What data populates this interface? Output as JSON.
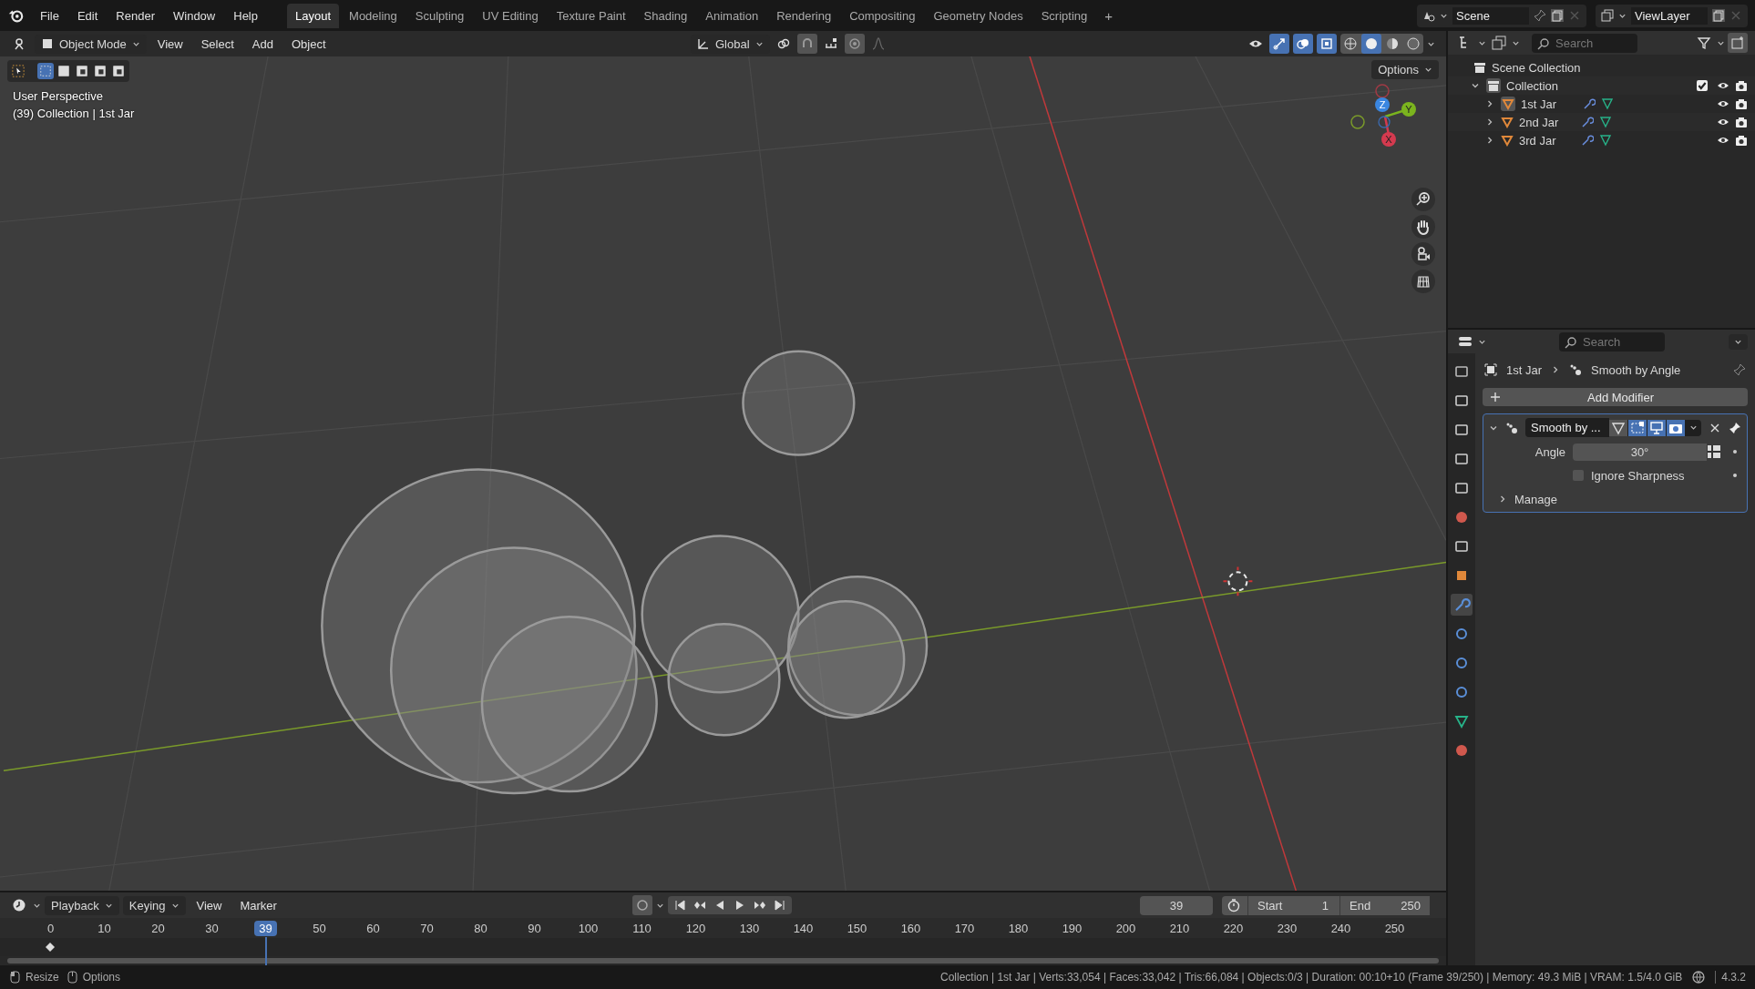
{
  "topbar": {
    "menus": [
      "File",
      "Edit",
      "Render",
      "Window",
      "Help"
    ],
    "workspaces": [
      {
        "label": "Layout",
        "selected": true
      },
      {
        "label": "Modeling",
        "selected": false
      },
      {
        "label": "Sculpting",
        "selected": false
      },
      {
        "label": "UV Editing",
        "selected": false
      },
      {
        "label": "Texture Paint",
        "selected": false
      },
      {
        "label": "Shading",
        "selected": false
      },
      {
        "label": "Animation",
        "selected": false
      },
      {
        "label": "Rendering",
        "selected": false
      },
      {
        "label": "Compositing",
        "selected": false
      },
      {
        "label": "Geometry Nodes",
        "selected": false
      },
      {
        "label": "Scripting",
        "selected": false
      }
    ],
    "add_tab": "+",
    "scene": "Scene",
    "view_layer": "ViewLayer"
  },
  "viewport": {
    "mode": "Object Mode",
    "menus": [
      "View",
      "Select",
      "Add",
      "Object"
    ],
    "orientation": "Global",
    "options": "Options",
    "select_modes": [
      {
        "selected": true
      },
      {
        "selected": false
      },
      {
        "selected": false
      },
      {
        "selected": false
      },
      {
        "selected": false
      }
    ],
    "shading": [
      {
        "selected": false
      },
      {
        "selected": true
      },
      {
        "selected": false
      },
      {
        "selected": false
      }
    ],
    "overlay_lines": [
      "User Perspective",
      "(39) Collection | 1st Jar"
    ],
    "axes": [
      "X",
      "Y",
      "Z"
    ]
  },
  "outliner": {
    "search_placeholder": "Search",
    "tree": [
      {
        "label": "Scene Collection",
        "children": [
          {
            "label": "Collection",
            "expanded": true,
            "checked": true,
            "children": [
              {
                "label": "1st Jar",
                "expanded": false,
                "selected": true
              },
              {
                "label": "2nd Jar",
                "expanded": false,
                "selected": false
              },
              {
                "label": "3rd Jar",
                "expanded": false,
                "selected": false
              }
            ]
          }
        ]
      }
    ]
  },
  "properties": {
    "search_placeholder": "Search",
    "tabs": [
      {
        "kind": "tool",
        "selected": false
      },
      {
        "kind": "render",
        "selected": false
      },
      {
        "kind": "output",
        "selected": false
      },
      {
        "kind": "viewlayer",
        "selected": false
      },
      {
        "kind": "scene",
        "selected": false
      },
      {
        "kind": "world",
        "selected": false
      },
      {
        "kind": "collection",
        "selected": false
      },
      {
        "kind": "object",
        "selected": false
      },
      {
        "kind": "modifier",
        "selected": true
      },
      {
        "kind": "particles",
        "selected": false
      },
      {
        "kind": "physics",
        "selected": false
      },
      {
        "kind": "constraints",
        "selected": false
      },
      {
        "kind": "data",
        "selected": false
      },
      {
        "kind": "material",
        "selected": false
      }
    ],
    "object": "1st Jar",
    "modifier": "Smooth by Angle",
    "add_button": "Add Modifier",
    "panel": {
      "name": "Smooth by ...",
      "expanded": true,
      "toggles": [
        {
          "kind": "editmode",
          "on": false
        },
        {
          "kind": "cage",
          "on": true
        },
        {
          "kind": "viewport",
          "on": true
        },
        {
          "kind": "render",
          "on": true
        }
      ],
      "angle_label": "Angle",
      "angle": "30°",
      "ignore_label": "Ignore Sharpness",
      "ignore_checked": false,
      "manage": "Manage",
      "manage_expanded": false
    }
  },
  "timeline": {
    "menus": [
      "Playback",
      "Keying",
      "View",
      "Marker"
    ],
    "current_frame": "39",
    "start_label": "Start",
    "start": "1",
    "end_label": "End",
    "end": "250",
    "ticks": [
      {
        "label": "0",
        "selected": false
      },
      {
        "label": "10",
        "selected": false
      },
      {
        "label": "20",
        "selected": false
      },
      {
        "label": "30",
        "selected": false
      },
      {
        "label": "39",
        "selected": true
      },
      {
        "label": "50",
        "selected": false
      },
      {
        "label": "60",
        "selected": false
      },
      {
        "label": "70",
        "selected": false
      },
      {
        "label": "80",
        "selected": false
      },
      {
        "label": "90",
        "selected": false
      },
      {
        "label": "100",
        "selected": false
      },
      {
        "label": "110",
        "selected": false
      },
      {
        "label": "120",
        "selected": false
      },
      {
        "label": "130",
        "selected": false
      },
      {
        "label": "140",
        "selected": false
      },
      {
        "label": "150",
        "selected": false
      },
      {
        "label": "160",
        "selected": false
      },
      {
        "label": "170",
        "selected": false
      },
      {
        "label": "180",
        "selected": false
      },
      {
        "label": "190",
        "selected": false
      },
      {
        "label": "200",
        "selected": false
      },
      {
        "label": "210",
        "selected": false
      },
      {
        "label": "220",
        "selected": false
      },
      {
        "label": "230",
        "selected": false
      },
      {
        "label": "240",
        "selected": false
      },
      {
        "label": "250",
        "selected": false
      }
    ]
  },
  "status": {
    "hints": [
      "Resize",
      "Options"
    ],
    "stats": "Collection | 1st Jar | Verts:33,054 | Faces:33,042 | Tris:66,084 | Objects:0/3 | Duration: 00:10+10 (Frame 39/250) | Memory: 49.3 MiB | VRAM: 1.5/4.0 GiB",
    "version": "4.3.2"
  }
}
